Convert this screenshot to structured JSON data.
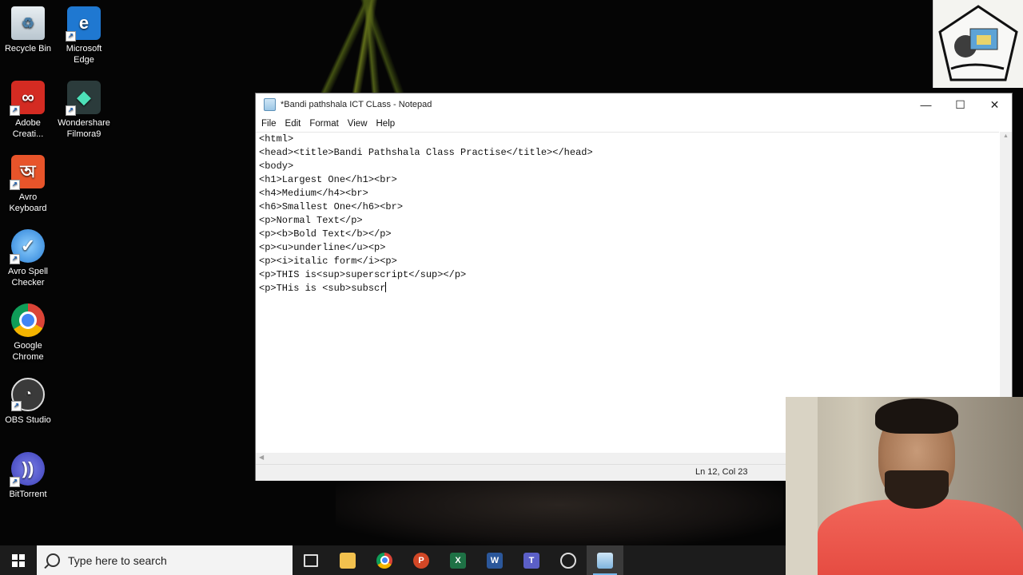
{
  "desktop": {
    "icons": [
      {
        "label": "Recycle Bin"
      },
      {
        "label": "Microsoft Edge"
      },
      {
        "label": "Adobe Creati..."
      },
      {
        "label": "Wondershare Filmora9"
      },
      {
        "label": "Avro Keyboard"
      },
      {
        "label": "Avro Spell Checker"
      },
      {
        "label": "Google Chrome"
      },
      {
        "label": "OBS Studio"
      },
      {
        "label": "BitTorrent"
      }
    ]
  },
  "notepad": {
    "title": "*Bandi pathshala ICT CLass - Notepad",
    "menu": [
      "File",
      "Edit",
      "Format",
      "View",
      "Help"
    ],
    "lines": [
      "<html>",
      "<head><title>Bandi Pathshala Class Practise</title></head>",
      "<body>",
      "<h1>Largest One</h1><br>",
      "<h4>Medium</h4><br>",
      "<h6>Smallest One</h6><br>",
      "<p>Normal Text</p>",
      "<p><b>Bold Text</b></p>",
      "<p><u>underline</u><p>",
      "<p><i>italic form</i><p>",
      "<p>THIS is<sup>superscript</sup></p>",
      "<p>THis is <sub>subscr"
    ],
    "status": {
      "position": "Ln 12, Col 23"
    }
  },
  "taskbar": {
    "search_placeholder": "Type here to search",
    "apps": [
      "task-view",
      "file-explorer",
      "google-chrome",
      "powerpoint",
      "excel",
      "word",
      "teams",
      "obs-studio",
      "notepad"
    ]
  },
  "colors": {
    "desktop_bg": "#050505",
    "taskbar_bg": "#1c1c1c",
    "accent": "#76b9ed"
  }
}
